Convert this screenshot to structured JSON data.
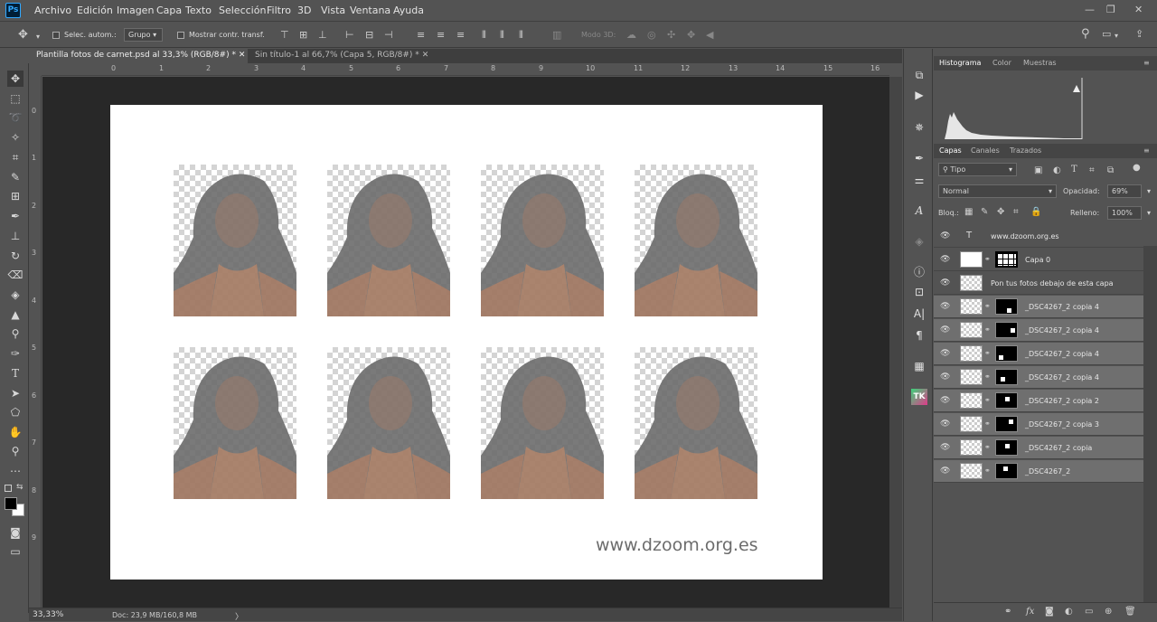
{
  "app": {
    "logo": "Ps"
  },
  "menu": [
    "Archivo",
    "Edición",
    "Imagen",
    "Capa",
    "Texto",
    "Selección",
    "Filtro",
    "3D",
    "Vista",
    "Ventana",
    "Ayuda"
  ],
  "window_controls": {
    "minimize": "—",
    "restore": "❐",
    "close": "✕"
  },
  "options": {
    "auto_select_label": "Selec. autom.:",
    "auto_select_target": "Grupo",
    "show_transform_label": "Mostrar contr. transf.",
    "mode3d_label": "Modo 3D:"
  },
  "tabs": [
    {
      "label": "Plantilla fotos de carnet.psd al 33,3% (RGB/8#) *",
      "close": "✕",
      "active": true
    },
    {
      "label": "Sin título-1 al 66,7% (Capa 5, RGB/8#) *",
      "close": "✕",
      "active": false
    }
  ],
  "ruler": {
    "h_ticks": [
      "0",
      "1",
      "2",
      "3",
      "4",
      "5",
      "6",
      "7",
      "8",
      "9",
      "10",
      "11",
      "12",
      "13",
      "14",
      "15",
      "16"
    ],
    "v_ticks": [
      "0",
      "1",
      "2",
      "3",
      "4",
      "5",
      "6",
      "7",
      "8",
      "9"
    ]
  },
  "document": {
    "watermark": "www.dzoom.org.es",
    "photo_count": 8
  },
  "status": {
    "zoom": "33,33%",
    "doc_info": "Doc: 23,9 MB/160,8 MB",
    "arrow": "〉"
  },
  "panels": {
    "top_tabs": [
      "Histograma",
      "Color",
      "Muestras"
    ],
    "layers_tabs": [
      "Capas",
      "Canales",
      "Trazados"
    ],
    "filter_kind": "Tipo",
    "blend_mode": "Normal",
    "opacity_label": "Opacidad:",
    "opacity_value": "69%",
    "lock_label": "Bloq.:",
    "fill_label": "Relleno:",
    "fill_value": "100%"
  },
  "layers": [
    {
      "name": "www.dzoom.org.es",
      "kind": "text",
      "selected": false
    },
    {
      "name": "Capa 0",
      "kind": "grid",
      "selected": false
    },
    {
      "name": "Pon tus fotos debajo de esta capa",
      "kind": "plain",
      "selected": false
    },
    {
      "name": "_DSC4267_2 copia 4",
      "kind": "masked",
      "selected": true
    },
    {
      "name": "_DSC4267_2 copia 4",
      "kind": "masked",
      "selected": true
    },
    {
      "name": "_DSC4267_2 copia 4",
      "kind": "masked",
      "selected": true
    },
    {
      "name": "_DSC4267_2 copia 4",
      "kind": "masked",
      "selected": true
    },
    {
      "name": "_DSC4267_2 copia 2",
      "kind": "masked",
      "selected": true
    },
    {
      "name": "_DSC4267_2 copia 3",
      "kind": "masked",
      "selected": true
    },
    {
      "name": "_DSC4267_2 copia",
      "kind": "masked",
      "selected": true
    },
    {
      "name": "_DSC4267_2",
      "kind": "masked",
      "selected": true
    }
  ],
  "colors": {
    "ui_bg": "#535353",
    "canvas_bg": "#282828",
    "selected_layer": "#6f6f6f",
    "accent_ps": "#31a8ff"
  }
}
